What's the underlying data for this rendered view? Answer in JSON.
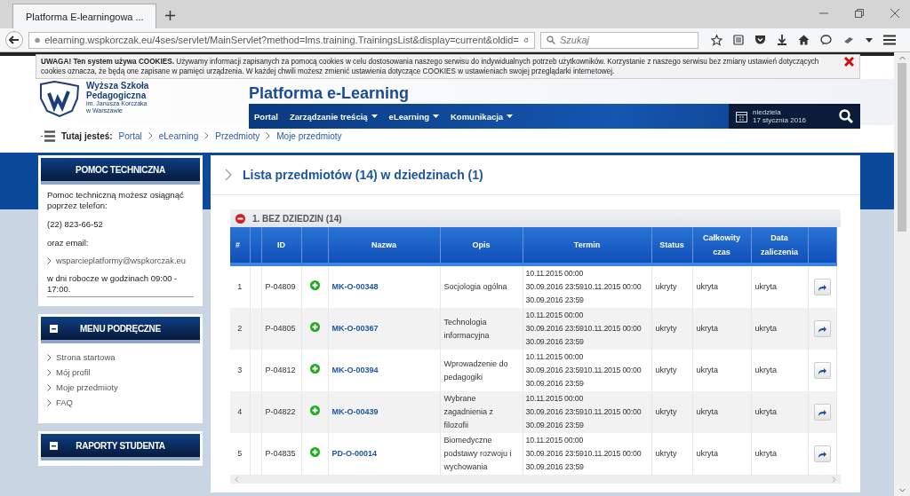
{
  "browser": {
    "tab_title": "Platforma E-learningowa ...",
    "url": "elearning.wspkorczak.eu/4ses/servlet/MainServlet?method=lms.training.TrainingsList&display=current&oldid=",
    "search_placeholder": "Szukaj"
  },
  "cookie_banner": {
    "text": "**UWAGA! Ten system używa COOKIES.** Używamy informacji zapisanych za pomocą cookies w celu dostosowania naszego serwisu do indywidualnych potrzeb użytkowników. Korzystanie z naszego serwisu bez zmiany ustawień dotyczących cookies oznacza, że będą one zapisane w pamięci urządzenia. W każdej chwili możesz zmienić ustawienia dotyczące COOKIES w ustawieniach swojej przeglądarki internetowej."
  },
  "header": {
    "logo_lines": [
      "Wyższa Szkoła",
      "Pedagogiczna",
      "im. Janusza Korczaka",
      "w Warszawie"
    ],
    "platform_title": "Platforma e-Learning",
    "nav": [
      {
        "label": "Portal",
        "dropdown": false
      },
      {
        "label": "Zarządzanie treścią",
        "dropdown": true
      },
      {
        "label": "eLearning",
        "dropdown": true
      },
      {
        "label": "Komunikacja",
        "dropdown": true
      }
    ],
    "date": {
      "day": "niedziela",
      "date": "17 stycznia 2016"
    }
  },
  "breadcrumb": {
    "label": "Tutaj jesteś:",
    "items": [
      "Portal",
      "eLearning",
      "Przedmioty",
      "Moje przedmioty"
    ]
  },
  "sidebar": [
    {
      "kind": "contact",
      "title": "POMOC TECHNICZNA",
      "collapsible": false,
      "lines": [
        {
          "kind": "text",
          "text": "Pomoc techniczną możesz osiągnąć poprzez telefon:"
        },
        {
          "kind": "text",
          "text": "(22) 823-66-52"
        },
        {
          "kind": "text",
          "text": "oraz email:"
        },
        {
          "kind": "link",
          "text": "wsparcieplatformy@wspkorczak.eu"
        },
        {
          "kind": "text",
          "text": "w dni robocze w godzinach 09:00 - 17:00."
        }
      ]
    },
    {
      "kind": "menu",
      "title": "MENU PODRĘCZNE",
      "collapsible": true,
      "lines": [
        {
          "kind": "link",
          "text": "Strona startowa"
        },
        {
          "kind": "link",
          "text": "Mój profil"
        },
        {
          "kind": "link",
          "text": "Moje przedmioty"
        },
        {
          "kind": "link",
          "text": "FAQ"
        }
      ]
    },
    {
      "title": "RAPORTY STUDENTA",
      "collapsible": true
    }
  ],
  "main": {
    "title": "Lista przedmiotów (14) w dziedzinach (1)",
    "group": {
      "title": "1. BEZ DZIEDZIN (14)",
      "expanded": true
    },
    "columns": [
      "#",
      "",
      "ID",
      "",
      "Nazwa",
      "Opis",
      "Termin",
      "Status",
      "Całkowity czas",
      "Data zaliczenia",
      ""
    ],
    "rows": [
      {
        "num": "1",
        "id": "P-04809",
        "code": "MK-O-00348",
        "description": "Socjologia ogólna",
        "term": [
          "10.11.2015 00:00",
          "30.09.2016 23:5910.11.2015 00:00",
          "30.09.2016 23:59"
        ],
        "status": "ukryty",
        "total_time": "ukryta",
        "completion_date": "ukryta"
      },
      {
        "num": "2",
        "id": "P-04805",
        "code": "MK-O-00367",
        "description": "Technologia informacyjna",
        "term": [
          "10.11.2015 00:00",
          "30.09.2016 23:5910.11.2015 00:00",
          "30.09.2016 23:59"
        ],
        "status": "ukryty",
        "total_time": "ukryta",
        "completion_date": "ukryta"
      },
      {
        "num": "3",
        "id": "P-04812",
        "code": "MK-O-00394",
        "description": "Wprowadzenie do pedagogiki",
        "term": [
          "10.11.2015 00:00",
          "30.09.2016 23:5910.11.2015 00:00",
          "30.09.2016 23:59"
        ],
        "status": "ukryty",
        "total_time": "ukryta",
        "completion_date": "ukryta"
      },
      {
        "num": "4",
        "id": "P-04822",
        "code": "MK-O-00439",
        "description": "Wybrane zagadnienia z filozofii",
        "term": [
          "10.11.2015 00:00",
          "30.09.2016 23:5910.11.2015 00:00",
          "30.09.2016 23:59"
        ],
        "status": "ukryty",
        "total_time": "ukryta",
        "completion_date": "ukryta"
      },
      {
        "num": "5",
        "id": "P-04835",
        "code": "PD-O-00014",
        "description": "Biomedyczne podstawy rozwoju i wychowania",
        "term": [
          "10.11.2015 00:00",
          "30.09.2016 23:5910.11.2015 00:00",
          "30.09.2016 23:59"
        ],
        "status": "ukryty",
        "total_time": "ukryta",
        "completion_date": "ukryta"
      }
    ]
  }
}
